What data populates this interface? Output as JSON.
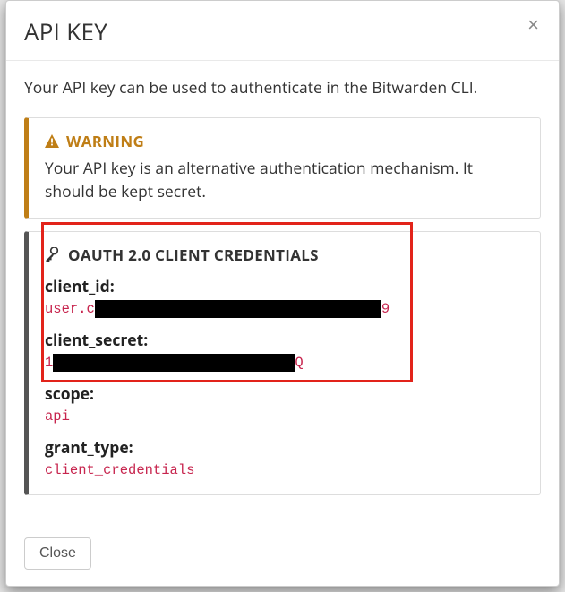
{
  "modal": {
    "title": "API KEY",
    "intro": "Your API key can be used to authenticate in the Bitwarden CLI.",
    "close_label": "Close"
  },
  "warning": {
    "heading": "WARNING",
    "body": "Your API key is an alternative authentication mechanism. It should be kept secret."
  },
  "creds": {
    "heading": "OAUTH 2.0 CLIENT CREDENTIALS",
    "client_id_label": "client_id:",
    "client_id_prefix": "user.c",
    "client_id_suffix": "9",
    "client_secret_label": "client_secret:",
    "client_secret_prefix": "1",
    "client_secret_suffix": "Q",
    "scope_label": "scope:",
    "scope_value": "api",
    "grant_type_label": "grant_type:",
    "grant_type_value": "client_credentials"
  },
  "colors": {
    "warning": "#bf7e16",
    "code": "#c7254e",
    "highlight_box": "#e2231a"
  }
}
